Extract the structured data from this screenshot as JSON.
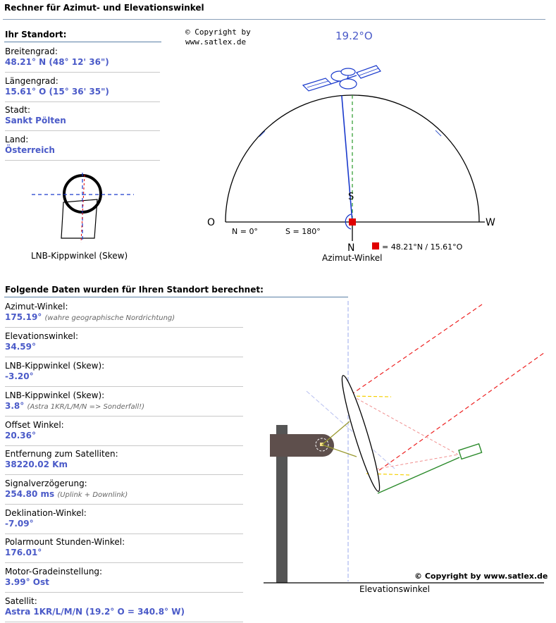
{
  "page_title": "Rechner für Azimut- und Elevationswinkel",
  "location": {
    "heading": "Ihr Standort:",
    "items": [
      {
        "label": "Breitengrad:",
        "value": "48.21° N (48° 12' 36\")"
      },
      {
        "label": "Längengrad:",
        "value": "15.61° O (15° 36' 35\")"
      },
      {
        "label": "Stadt:",
        "value": "Sankt Pölten"
      },
      {
        "label": "Land:",
        "value": "Österreich"
      }
    ]
  },
  "skew_caption": "LNB-Kippwinkel (Skew)",
  "azimuth_diagram": {
    "copyright_line1": "© Copyright by",
    "copyright_line2": "www.satlex.de",
    "satellite_label": "19.2°O",
    "label_o": "O",
    "label_w": "W",
    "label_s": "S",
    "label_n": "N",
    "label_n0": "N = 0°",
    "label_s180": "S = 180°",
    "position_legend": "= 48.21°N / 15.61°O",
    "caption": "Azimut-Winkel",
    "azimuth_deg": 175.19
  },
  "results": {
    "heading": "Folgende Daten wurden für Ihren Standort berechnet:",
    "items": [
      {
        "label": "Azimut-Winkel:",
        "value": "175.19°",
        "note": "(wahre geographische Nordrichtung)"
      },
      {
        "label": "Elevationswinkel:",
        "value": "34.59°",
        "note": ""
      },
      {
        "label": "LNB-Kippwinkel (Skew):",
        "value": "-3.20°",
        "note": ""
      },
      {
        "label": "LNB-Kippwinkel (Skew):",
        "value": "3.8°",
        "note": "(Astra 1KR/L/M/N => Sonderfall!)"
      },
      {
        "label": "Offset Winkel:",
        "value": "20.36°",
        "note": ""
      },
      {
        "label": "Entfernung zum Satelliten:",
        "value": "38220.02 Km",
        "note": ""
      },
      {
        "label": "Signalverzögerung:",
        "value": "254.80 ms",
        "note": "(Uplink + Downlink)"
      },
      {
        "label": "Deklination-Winkel:",
        "value": "-7.09°",
        "note": ""
      },
      {
        "label": "Polarmount Stunden-Winkel:",
        "value": "176.01°",
        "note": ""
      },
      {
        "label": "Motor-Gradeinstellung:",
        "value": "3.99° Ost",
        "note": ""
      },
      {
        "label": "Satellit:",
        "value": "Astra 1KR/L/M/N (19.2° O = 340.8° W)",
        "note": ""
      }
    ]
  },
  "elevation_diagram": {
    "copyright": "© Copyright by www.satlex.de",
    "caption": "Elevationswinkel",
    "elevation_deg": 34.59
  },
  "colors": {
    "value_blue": "#4a5ac8",
    "line_blue": "#1a3acc",
    "marker_red": "#e00000",
    "mast_gray": "#555555",
    "mount_brown": "#5e4f4c"
  }
}
